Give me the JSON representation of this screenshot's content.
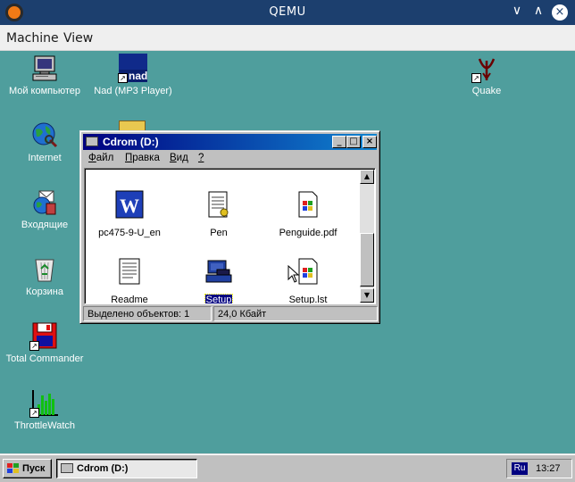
{
  "host": {
    "title": "QEMU",
    "menu": [
      "Machine",
      "View"
    ],
    "controls": {
      "minimize": "∨",
      "maximize": "∧",
      "close": "×"
    }
  },
  "desktop": {
    "background_color": "#4f9e9d",
    "icons": [
      {
        "label": "Мой компьютер",
        "icon": "my-computer-icon"
      },
      {
        "label": "Nad (MP3 Player)",
        "icon": "nad-mp3-player-icon",
        "badge": "nad"
      },
      {
        "label": "Quake",
        "icon": "quake-icon"
      },
      {
        "label": "Internet",
        "icon": "internet-globe-icon"
      },
      {
        "label": "Входящие",
        "icon": "inbox-icon"
      },
      {
        "label": "Корзина",
        "icon": "recycle-bin-icon"
      },
      {
        "label": "Total Commander",
        "icon": "total-commander-icon"
      },
      {
        "label": "ThrottleWatch",
        "icon": "throttlewatch-icon"
      }
    ]
  },
  "explorer": {
    "title": "Cdrom (D:)",
    "menu": [
      {
        "label": "Файл",
        "accel": "Ф",
        "rest": "айл"
      },
      {
        "label": "Правка",
        "accel": "П",
        "rest": "равка"
      },
      {
        "label": "Вид",
        "accel": "В",
        "rest": "ид"
      },
      {
        "label": "?",
        "accel": "?",
        "rest": ""
      }
    ],
    "files": [
      {
        "name": "pc475-9-U_en",
        "icon": "word-document-icon"
      },
      {
        "name": "Pen",
        "icon": "notepad-icon"
      },
      {
        "name": "Penguide.pdf",
        "icon": "windows-file-icon"
      },
      {
        "name": "Readme",
        "icon": "text-file-icon"
      },
      {
        "name": "Setup",
        "icon": "setup-program-icon",
        "selected": true
      },
      {
        "name": "Setup.lst",
        "icon": "windows-file-icon"
      }
    ],
    "status": {
      "selection": "Выделено объектов: 1",
      "size": "24,0 Кбайт"
    }
  },
  "taskbar": {
    "start_label": "Пуск",
    "task_label": "Cdrom (D:)",
    "language": "Ru",
    "clock": "13:27"
  }
}
